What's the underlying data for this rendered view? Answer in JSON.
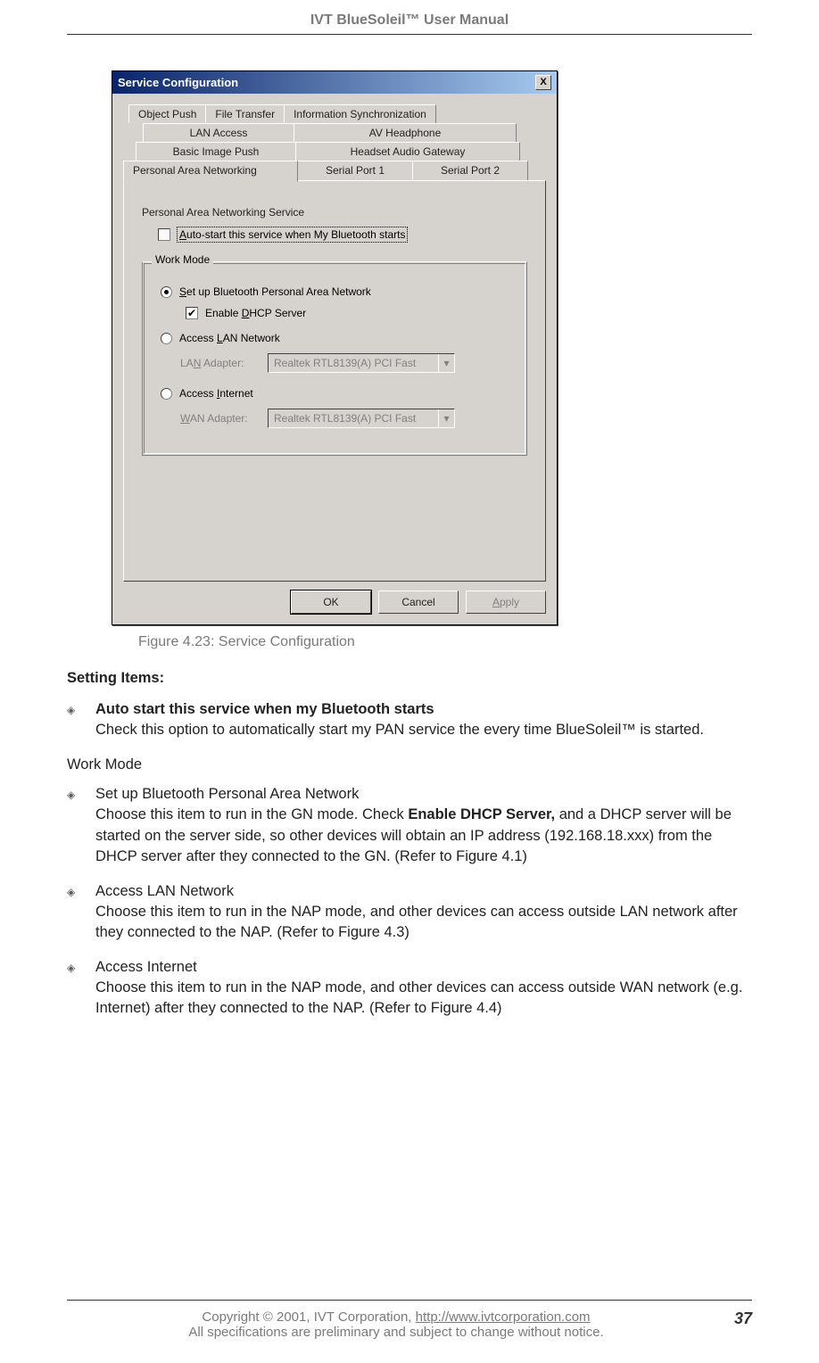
{
  "header": {
    "title": "IVT BlueSoleil™ User Manual"
  },
  "dialog": {
    "title": "Service Configuration",
    "tabs": {
      "row1": [
        "Object Push",
        "File Transfer",
        "Information Synchronization"
      ],
      "row2": [
        "LAN Access",
        "AV Headphone"
      ],
      "row3": [
        "Basic Image Push",
        "Headset Audio Gateway"
      ],
      "row4": [
        "Personal Area Networking",
        "Serial Port 1",
        "Serial Port 2"
      ]
    },
    "section_label": "Personal Area Networking Service",
    "autostart_label": "Auto-start this service when My Bluetooth starts",
    "group_legend": "Work Mode",
    "radio_setup": "Set up Bluetooth Personal Area Network",
    "enable_dhcp": "Enable DHCP Server",
    "radio_lan": "Access LAN Network",
    "lan_adapter_label": "LAN Adapter:",
    "lan_adapter_value": "Realtek RTL8139(A) PCI Fast",
    "radio_internet": "Access Internet",
    "wan_adapter_label": "WAN Adapter:",
    "wan_adapter_value": "Realtek RTL8139(A) PCI Fast",
    "ok": "OK",
    "cancel": "Cancel",
    "apply": "Apply"
  },
  "figure_caption": "Figure 4.23: Service Configuration",
  "body": {
    "setting_items_heading": "Setting Items:",
    "bullet1_title": "Auto start this service when my Bluetooth starts",
    "bullet1_text": "Check this option to automatically start my PAN service the every time BlueSoleil™ is started.",
    "work_mode_heading": "Work Mode",
    "bullet2_title": "Set up Bluetooth Personal Area Network",
    "bullet2_text_a": "Choose this item to run in the GN mode. Check ",
    "bullet2_bold": "Enable DHCP Server,",
    "bullet2_text_b": " and a DHCP server will be started on the server side, so other devices will obtain an IP address (192.168.18.xxx) from the DHCP server after they connected to the GN. (Refer to Figure 4.1)",
    "bullet3_title": "Access LAN Network",
    "bullet3_text": "Choose this item to run in the NAP mode, and other devices can access outside LAN network after they connected to the NAP. (Refer to Figure 4.3)",
    "bullet4_title": "Access Internet",
    "bullet4_text": "Choose this item to run in the NAP mode, and other devices can access outside WAN network (e.g. Internet) after they connected to the NAP. (Refer to Figure 4.4)"
  },
  "footer": {
    "line1a": "Copyright © 2001, IVT Corporation, ",
    "link": "http://www.ivtcorporation.com",
    "line2": "All specifications are preliminary and subject to change without notice.",
    "page": "37"
  }
}
